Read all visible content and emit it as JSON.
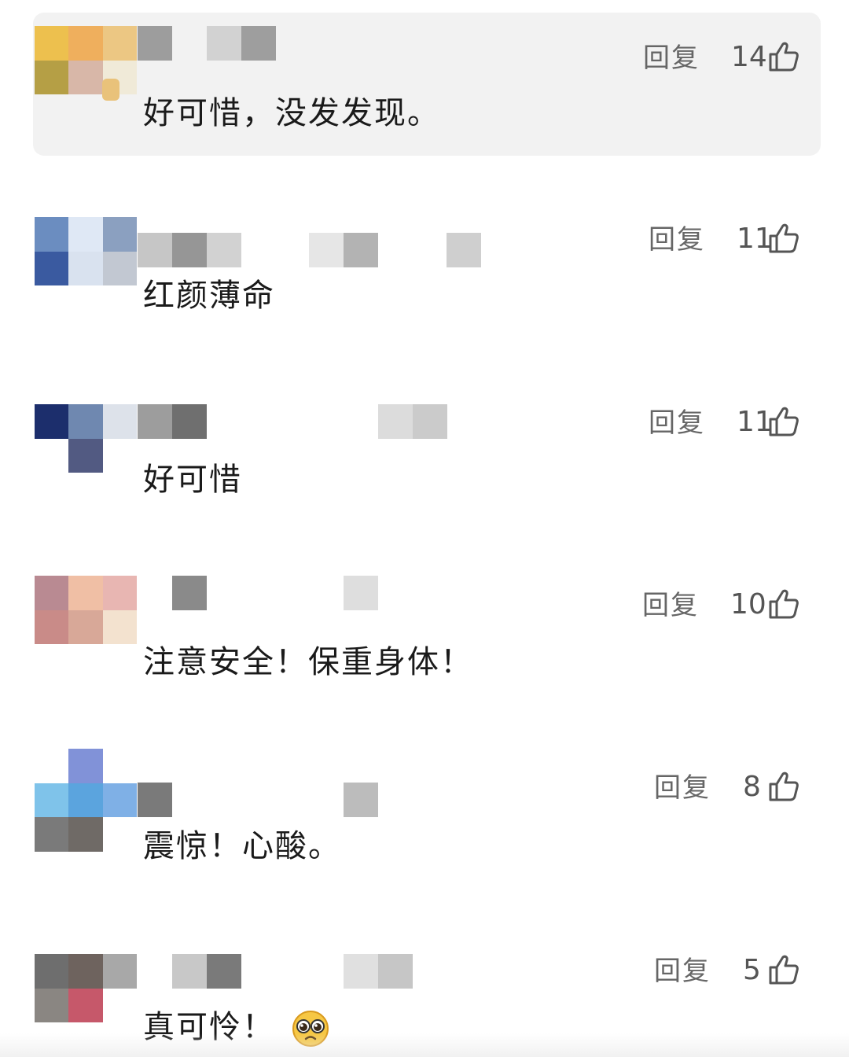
{
  "reply_label": "回复",
  "comments": [
    {
      "text": "好可惜，没发发现。",
      "likes": "14"
    },
    {
      "text": "红颜薄命",
      "likes": "11"
    },
    {
      "text": "好可惜",
      "likes": "11"
    },
    {
      "text": "注意安全！保重身体！",
      "likes": "10"
    },
    {
      "text": "震惊！心酸。",
      "likes": "8"
    },
    {
      "text": "真可怜！",
      "likes": "5",
      "emoji": "pleading-face-emoji"
    }
  ],
  "colors": {
    "highlight_bg": "#f2f2f2",
    "text": "#1a1a1a",
    "meta": "#666666"
  },
  "icons": [
    "thumbs-up-icon",
    "pleading-face-emoji"
  ]
}
